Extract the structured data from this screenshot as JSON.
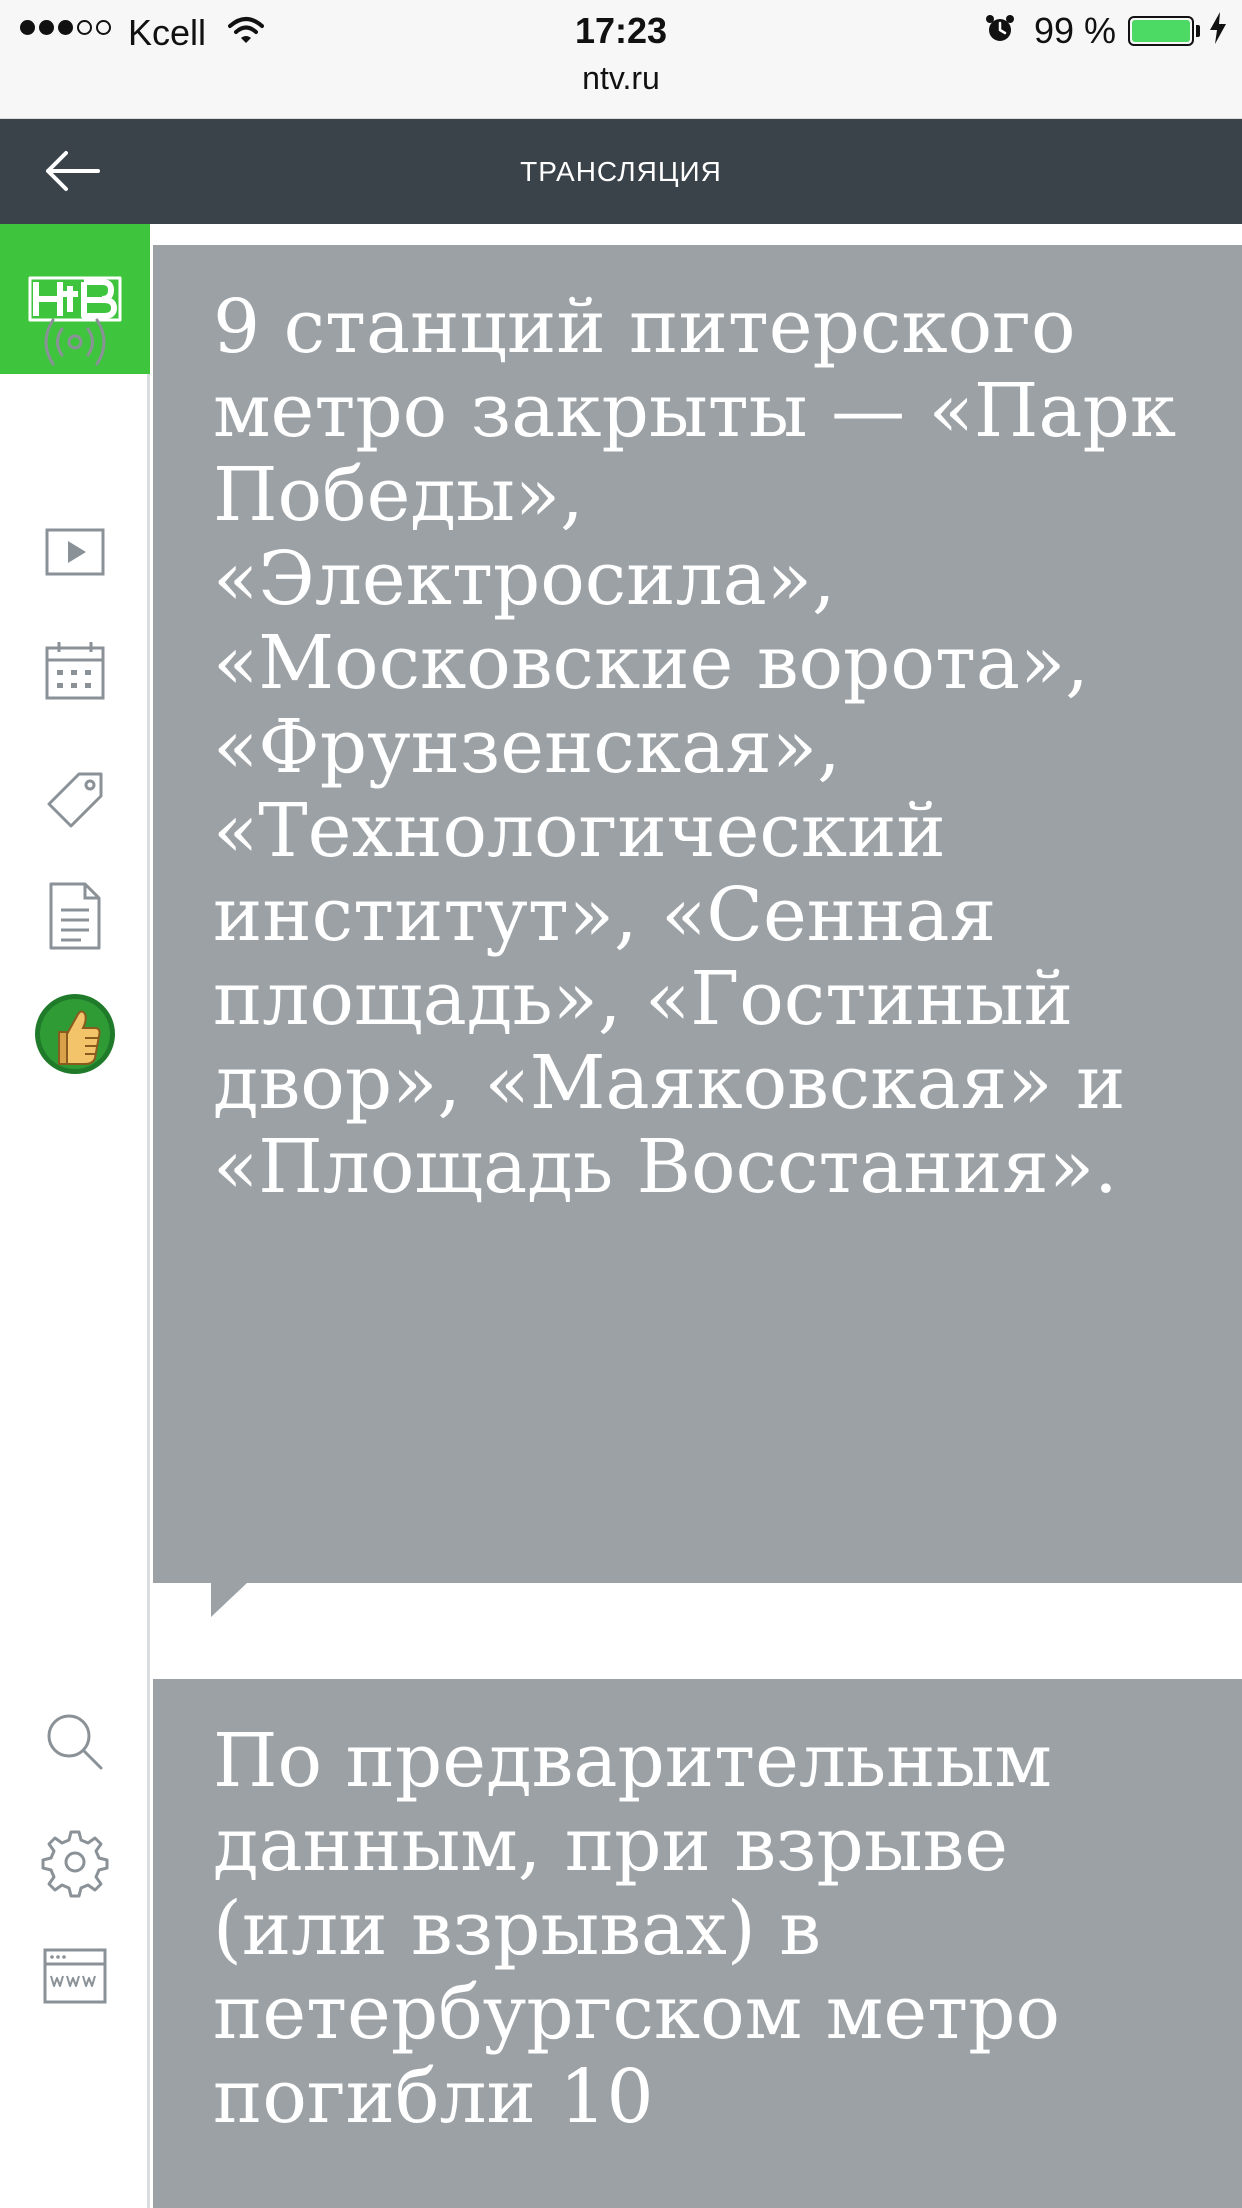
{
  "status_bar": {
    "carrier": "Kcell",
    "time": "17:23",
    "battery_percent": "99 %",
    "url": "ntv.ru",
    "signal_bars_filled": 3,
    "signal_bars_total": 5
  },
  "header": {
    "back_icon": "arrow-left-icon",
    "title": "ТРАНСЛЯЦИЯ"
  },
  "sidebar": {
    "logo_text": "НТВ",
    "logo_color": "#3ec43d",
    "items": [
      {
        "icon": "broadcast-icon"
      },
      {
        "icon": "play-icon"
      },
      {
        "icon": "calendar-icon"
      },
      {
        "icon": "tag-icon"
      },
      {
        "icon": "document-icon"
      },
      {
        "icon": "thumbs-up-icon"
      }
    ],
    "bottom_items": [
      {
        "icon": "search-icon"
      },
      {
        "icon": "gear-icon"
      },
      {
        "icon": "www-icon"
      }
    ]
  },
  "feed": {
    "cards": [
      {
        "text": "9 станций питерского метро закрыты — «Парк Победы», «Электросила», «Московские ворота», «Фрунзенская», «Технологический институт», «Сенная площадь», «Гостиный двор», «Маяковская» и «Площадь Восстания»."
      },
      {
        "text": "По предварительным данным, при взрыве (или взрывах) в петербургском метро погибли 10"
      }
    ],
    "card_color": "#9ba1a5"
  }
}
